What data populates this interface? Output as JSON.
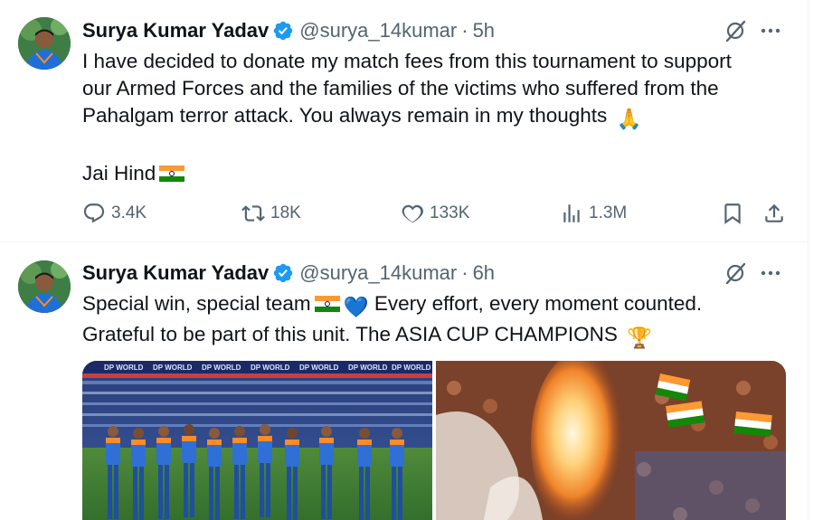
{
  "tweets": [
    {
      "author": "Surya Kumar Yadav",
      "handle": "@surya_14kumar",
      "separator": "·",
      "time": "5h",
      "text_lines": [
        "I have decided to donate my match fees from this tournament to support",
        "our Armed Forces and the families of the victims who suffered from the",
        "Pahalgam terror attack. You always remain in my thoughts"
      ],
      "text_line2": "Jai Hind",
      "emoji_pray": "🙏",
      "stats": {
        "replies": "3.4K",
        "reposts": "18K",
        "likes": "133K",
        "views": "1.3M"
      }
    },
    {
      "author": "Surya Kumar Yadav",
      "handle": "@surya_14kumar",
      "separator": "·",
      "time": "6h",
      "text_lines": [
        "Special win, special team",
        "Every effort, every moment counted.",
        "Grateful to be part of this unit. The ASIA CUP CHAMPIONS"
      ],
      "emoji_heart": "💙",
      "emoji_trophy": "🏆",
      "banner": [
        "DP WORLD",
        "DP WORLD",
        "DP WORLD",
        "DP WORLD",
        "DP WORLD",
        "DP WORLD",
        "DP WORLD"
      ]
    }
  ],
  "icons": {
    "verified": "verified-badge-icon",
    "grok": "grok-icon",
    "more": "more-icon",
    "reply": "reply-icon",
    "repost": "repost-icon",
    "like": "like-icon",
    "views": "views-icon",
    "bookmark": "bookmark-icon",
    "share": "share-icon"
  },
  "colors": {
    "verified": "#1d9bf0",
    "muted": "#536471",
    "text": "#0f1419",
    "saffron": "#ff9933",
    "green": "#138808"
  }
}
